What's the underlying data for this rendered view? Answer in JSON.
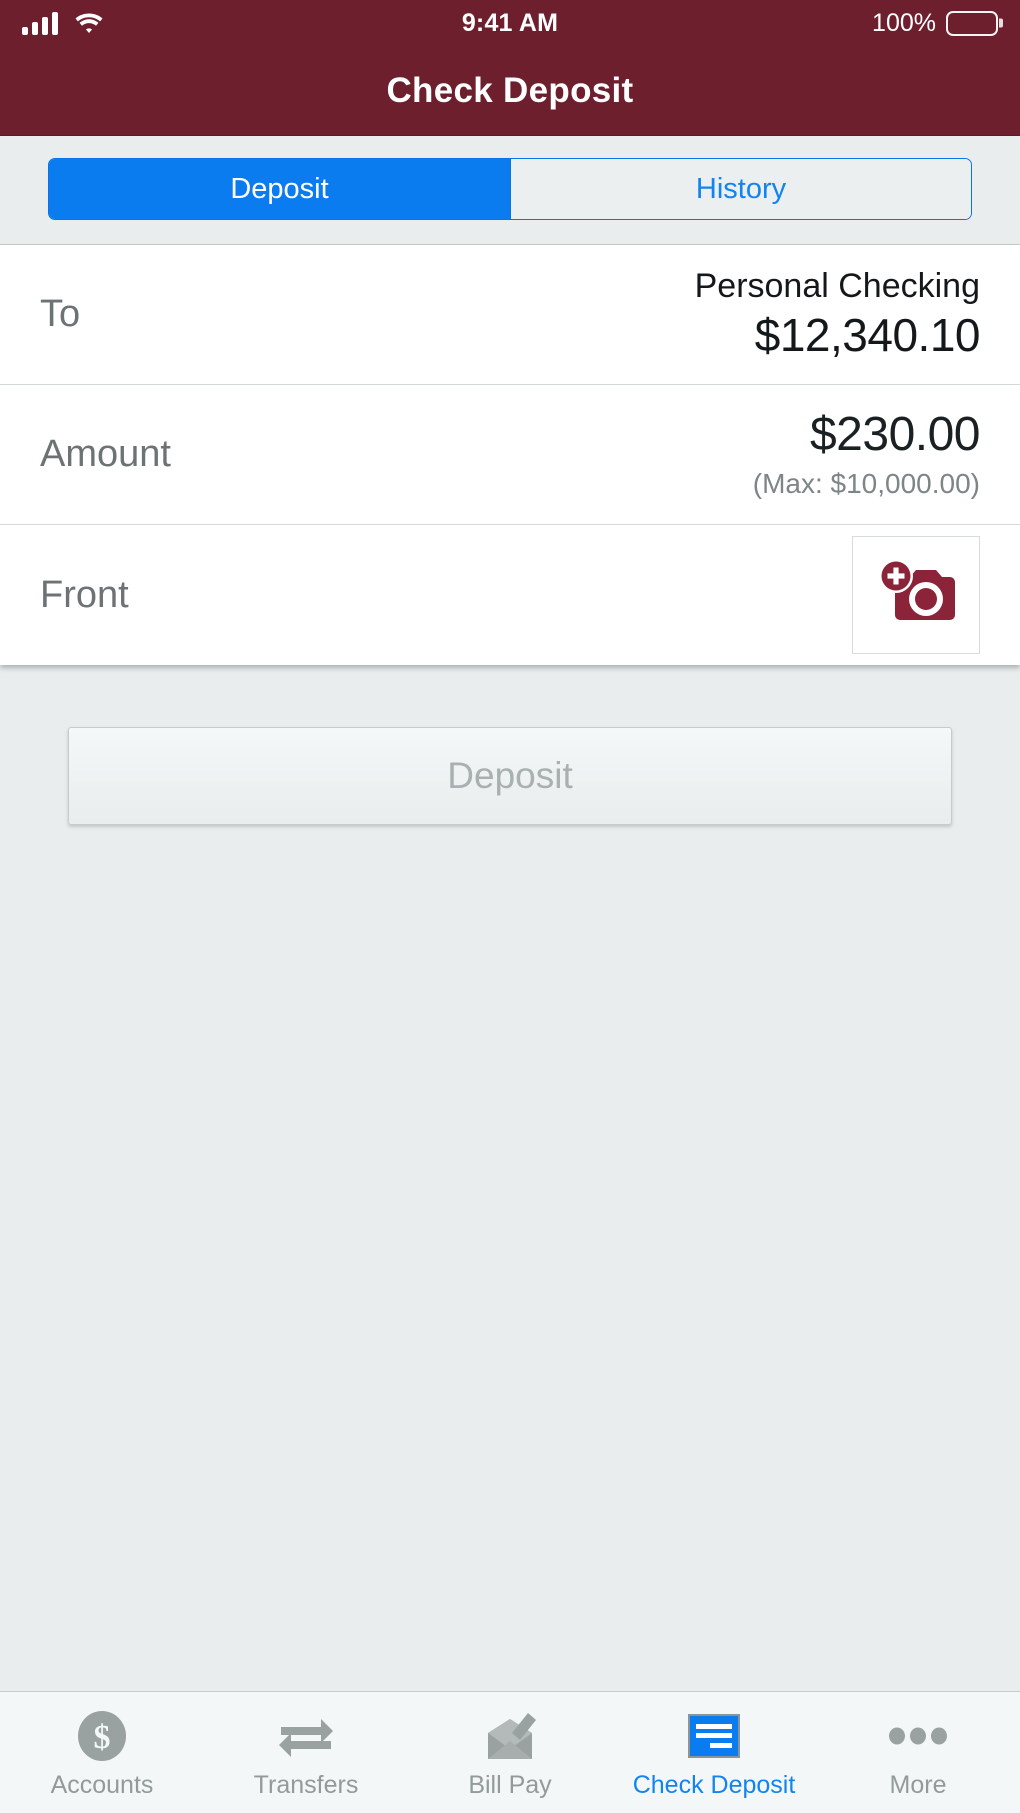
{
  "statusbar": {
    "time": "9:41 AM",
    "battery_pct": "100%",
    "signal_icon": "cellular-signal-icon",
    "wifi_icon": "wifi-icon",
    "battery_icon": "battery-full-icon"
  },
  "navbar": {
    "title": "Check Deposit",
    "background": "#6e1f2e"
  },
  "segmented": {
    "options": [
      {
        "label": "Deposit",
        "active": true
      },
      {
        "label": "History",
        "active": false
      }
    ],
    "active_color": "#0a7cf0",
    "inactive_text_color": "#1184f0"
  },
  "form": {
    "rows": [
      {
        "label": "To",
        "value_primary": "Personal Checking",
        "value_secondary": "$12,340.10"
      },
      {
        "label": "Amount",
        "value_primary": "$230.00",
        "value_secondary": "(Max: $10,000.00)"
      },
      {
        "label": "Front",
        "icon": "add-camera-icon",
        "icon_color": "#8b2439"
      }
    ]
  },
  "action": {
    "deposit_label": "Deposit",
    "disabled": true
  },
  "tabbar": {
    "items": [
      {
        "label": "Accounts",
        "icon": "dollar-circle-icon",
        "active": false
      },
      {
        "label": "Transfers",
        "icon": "transfer-arrows-icon",
        "active": false
      },
      {
        "label": "Bill Pay",
        "icon": "envelope-pen-icon",
        "active": false
      },
      {
        "label": "Check Deposit",
        "icon": "check-document-icon",
        "active": true
      },
      {
        "label": "More",
        "icon": "ellipsis-icon",
        "active": false
      }
    ],
    "active_color": "#1184f0",
    "inactive_color": "#939a9a"
  }
}
